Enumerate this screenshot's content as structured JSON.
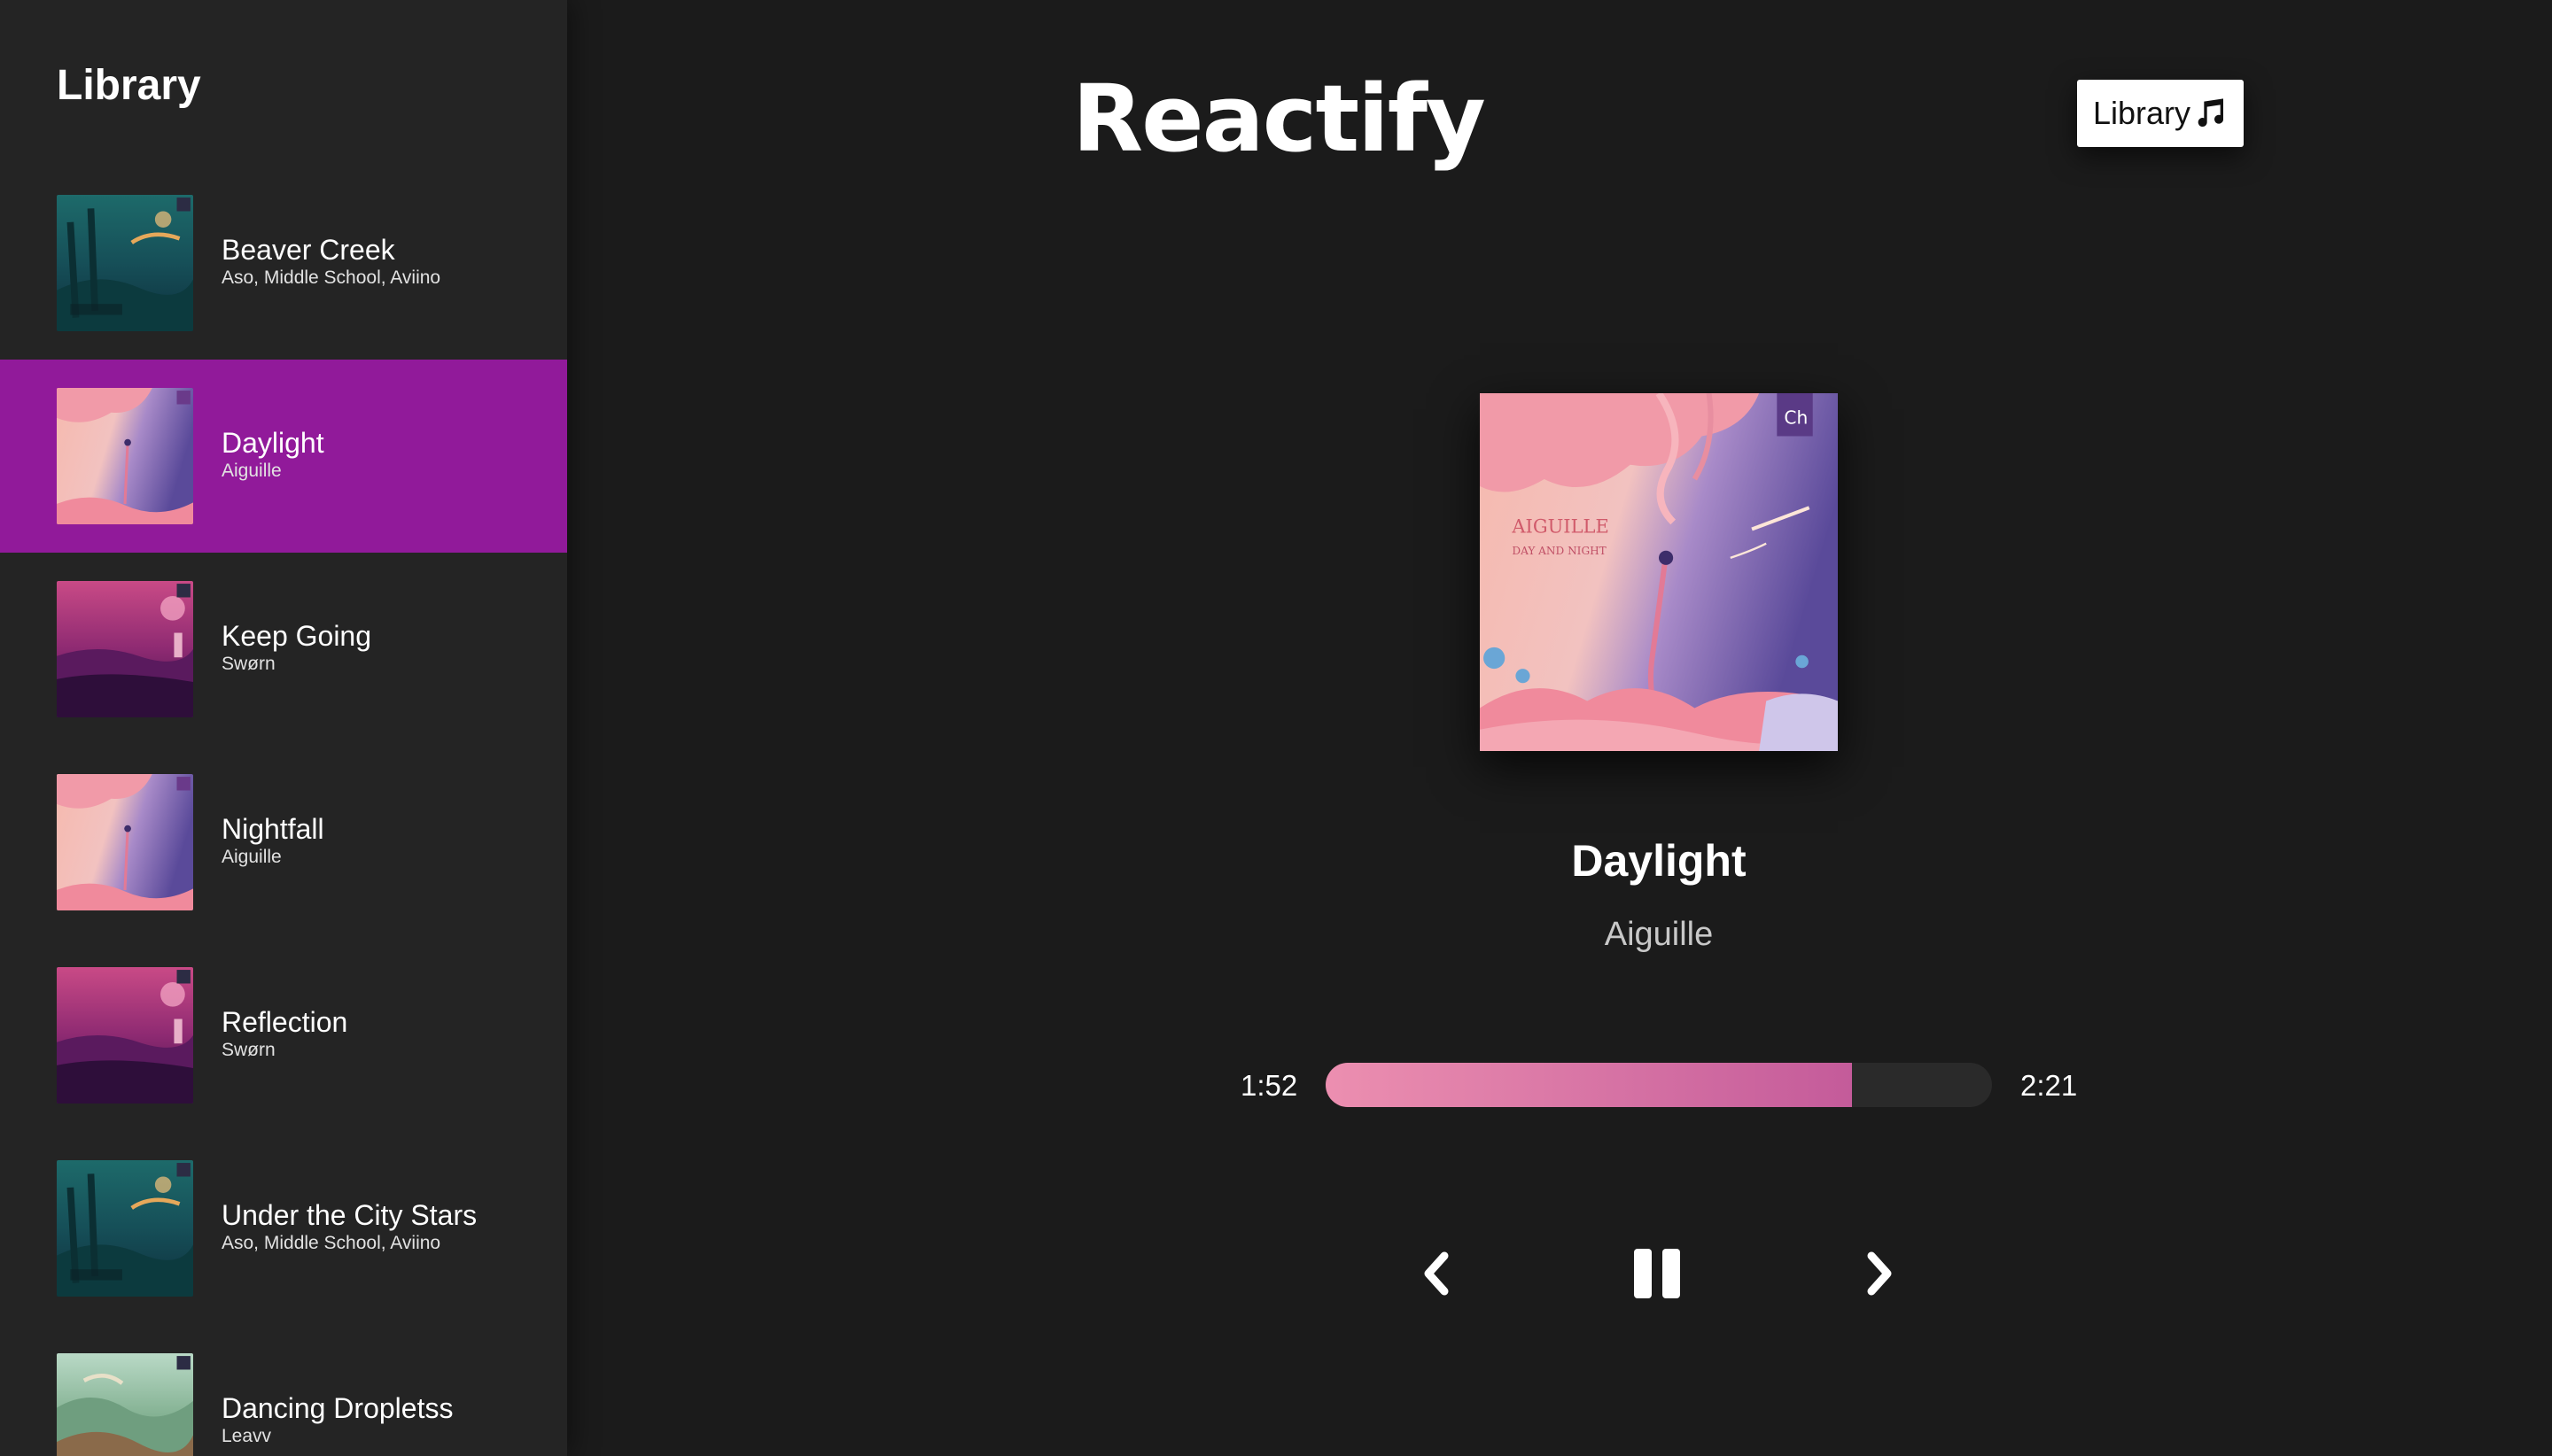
{
  "sidebar": {
    "title": "Library",
    "songs": [
      {
        "name": "Beaver Creek",
        "artist": "Aso, Middle School, Aviino",
        "cover": "teal-forest",
        "selected": false
      },
      {
        "name": "Daylight",
        "artist": "Aiguille",
        "cover": "pink-sky",
        "selected": true
      },
      {
        "name": "Keep Going",
        "artist": "Swørn",
        "cover": "magenta-lake",
        "selected": false
      },
      {
        "name": "Nightfall",
        "artist": "Aiguille",
        "cover": "pink-sky",
        "selected": false
      },
      {
        "name": "Reflection",
        "artist": "Swørn",
        "cover": "magenta-lake",
        "selected": false
      },
      {
        "name": "Under the City Stars",
        "artist": "Aso, Middle School, Aviino",
        "cover": "teal-forest",
        "selected": false
      },
      {
        "name": "Dancing Dropletss",
        "artist": "Leavv",
        "cover": "green-hills",
        "selected": false
      }
    ]
  },
  "header": {
    "logo": "Reactify",
    "library_button_label": "Library",
    "library_button_icon": "music-note-icon"
  },
  "player": {
    "title": "Daylight",
    "artist": "Aiguille",
    "current_time": "1:52",
    "total_time": "2:21",
    "progress": 0.79,
    "prev_icon": "chevron-left-icon",
    "pause_icon": "pause-icon",
    "next_icon": "chevron-right-icon"
  },
  "colors": {
    "background": "#1b1b1b",
    "sidebar": "#242424",
    "selected_row": "#911a9a",
    "progress_start": "#ec8fb0",
    "progress_end": "#c45b9a"
  }
}
